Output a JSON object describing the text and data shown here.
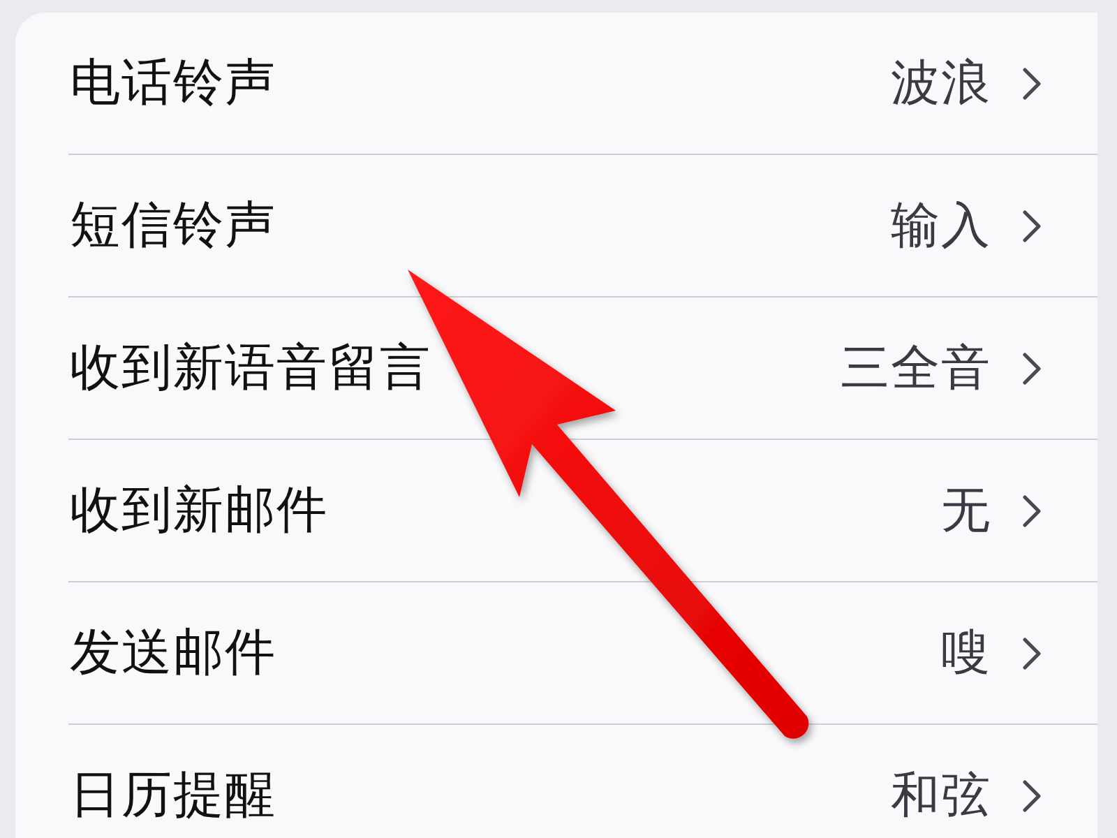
{
  "rows": [
    {
      "label": "电话铃声",
      "value": "波浪"
    },
    {
      "label": "短信铃声",
      "value": "输入"
    },
    {
      "label": "收到新语音留言",
      "value": "三全音"
    },
    {
      "label": "收到新邮件",
      "value": "无"
    },
    {
      "label": "发送邮件",
      "value": "嗖"
    },
    {
      "label": "日历提醒",
      "value": "和弦"
    }
  ]
}
